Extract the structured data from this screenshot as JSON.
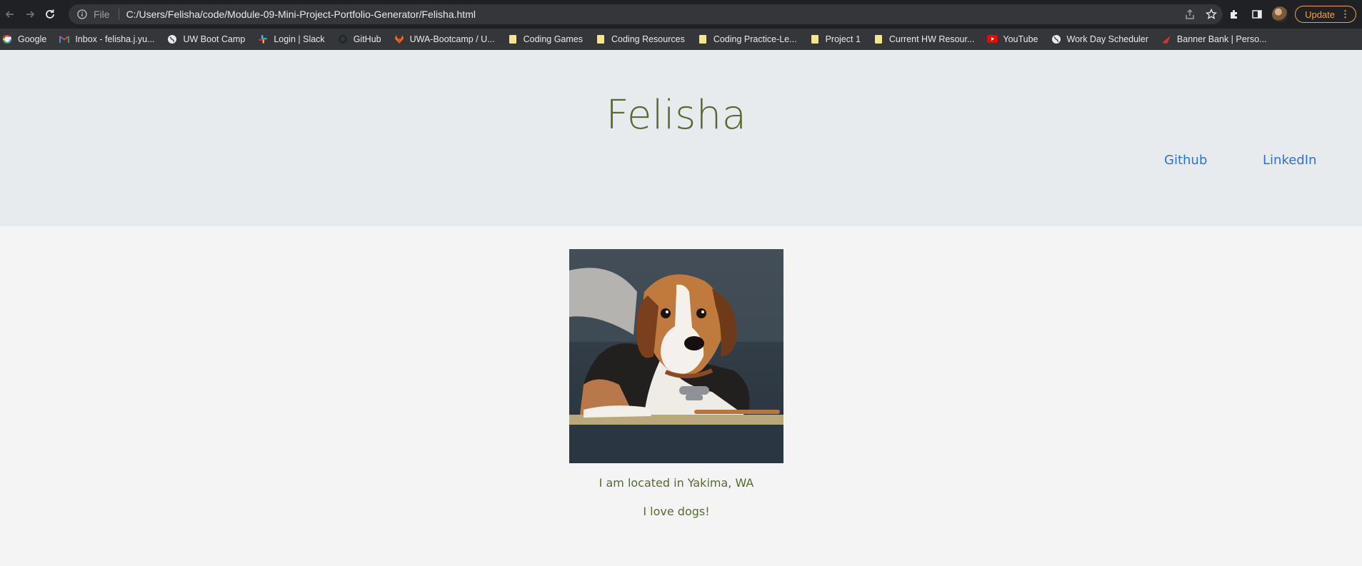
{
  "browser": {
    "file_label": "File",
    "url": "C:/Users/Felisha/code/Module-09-Mini-Project-Portfolio-Generator/Felisha.html",
    "update_label": "Update",
    "bookmarks": [
      {
        "label": "Google",
        "icon": "google-icon"
      },
      {
        "label": "Inbox - felisha.j.yu...",
        "icon": "gmail-icon"
      },
      {
        "label": "UW Boot Camp",
        "icon": "globe-icon"
      },
      {
        "label": "Login | Slack",
        "icon": "slack-icon"
      },
      {
        "label": "GitHub",
        "icon": "github-icon"
      },
      {
        "label": "UWA-Bootcamp / U...",
        "icon": "gitlab-icon"
      },
      {
        "label": "Coding Games",
        "icon": "folder-icon"
      },
      {
        "label": "Coding Resources",
        "icon": "folder-icon"
      },
      {
        "label": "Coding Practice-Le...",
        "icon": "folder-icon"
      },
      {
        "label": "Project 1",
        "icon": "folder-icon"
      },
      {
        "label": "Current HW Resour...",
        "icon": "folder-icon"
      },
      {
        "label": "YouTube",
        "icon": "youtube-icon"
      },
      {
        "label": "Work Day Scheduler",
        "icon": "globe-icon"
      },
      {
        "label": "Banner Bank | Perso...",
        "icon": "banner-bank-icon"
      }
    ]
  },
  "page": {
    "title": "Felisha",
    "nav": {
      "github": "Github",
      "linkedin": "LinkedIn"
    },
    "location": "I am located in Yakima, WA",
    "hobby": "I love dogs!"
  },
  "colors": {
    "title": "#556b2f",
    "link": "#2f6fd6",
    "header_bg": "#e8ebee",
    "page_bg": "#f4f4f4"
  }
}
